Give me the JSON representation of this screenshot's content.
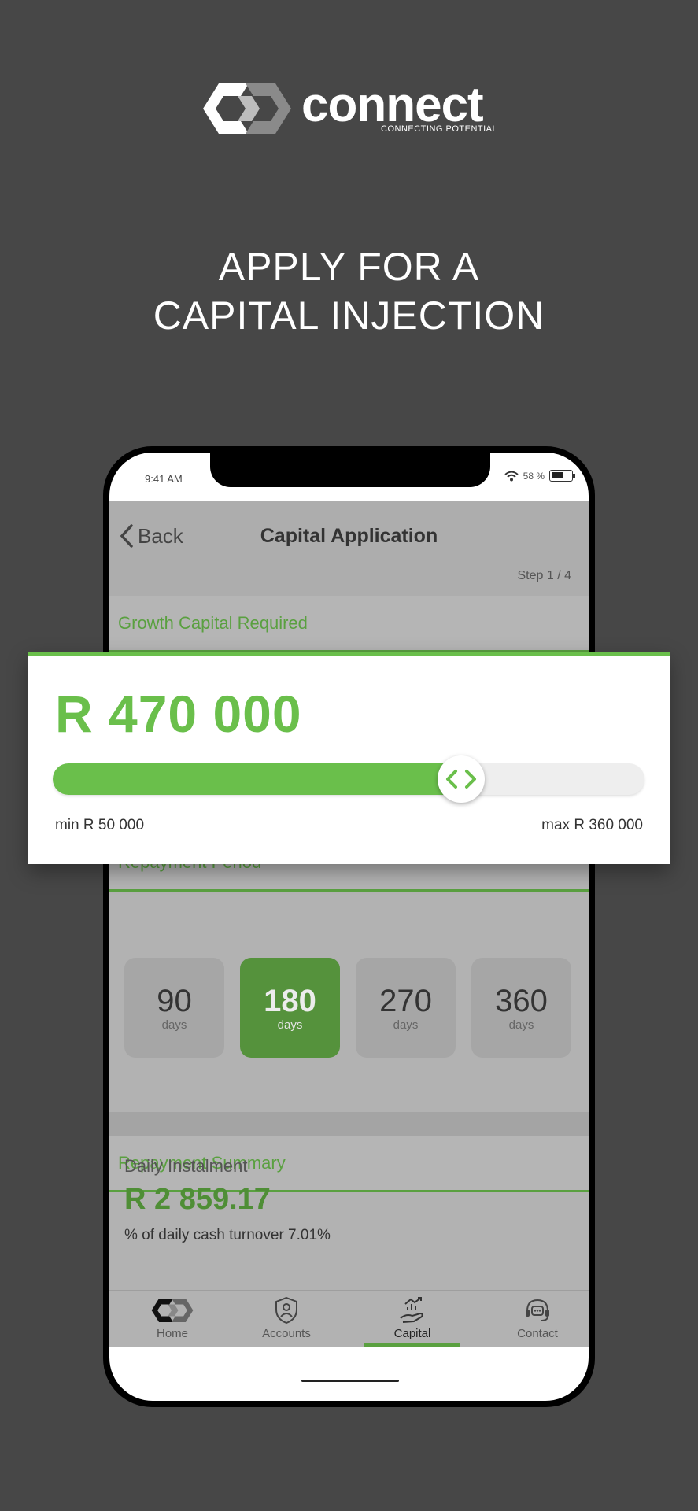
{
  "brand": {
    "name": "connect",
    "tagline": "CONNECTING POTENTIAL"
  },
  "headline": {
    "line1": "APPLY FOR A",
    "line2": "CAPITAL INJECTION"
  },
  "status_bar": {
    "time": "9:41 AM",
    "battery": "58 %"
  },
  "nav": {
    "back_label": "Back",
    "title": "Capital Application",
    "step": "Step 1 / 4"
  },
  "sections": {
    "growth": "Growth Capital Required",
    "repayment_period": "Repayment Period",
    "repayment_summary": "Repayment Summary"
  },
  "slider": {
    "amount": "R 470 000",
    "min_label": "min R 50 000",
    "max_label": "max R 360 000",
    "fill_fraction": 0.69
  },
  "repayment_options": [
    {
      "value": "90",
      "unit": "days",
      "selected": false
    },
    {
      "value": "180",
      "unit": "days",
      "selected": true
    },
    {
      "value": "270",
      "unit": "days",
      "selected": false
    },
    {
      "value": "360",
      "unit": "days",
      "selected": false
    }
  ],
  "summary": {
    "label": "Daily Instalment",
    "amount": "R 2 859.17",
    "turnover": "% of daily cash turnover 7.01%"
  },
  "tabs": [
    {
      "label": "Home",
      "icon": "logo-icon",
      "active": false
    },
    {
      "label": "Accounts",
      "icon": "shield-user-icon",
      "active": false
    },
    {
      "label": "Capital",
      "icon": "hand-growth-icon",
      "active": true
    },
    {
      "label": "Contact",
      "icon": "headset-chat-icon",
      "active": false
    }
  ],
  "colors": {
    "background": "#474747",
    "accent_green": "#6abf4b",
    "dark_green": "#55923c",
    "overlay_gray": "#b2b2b2"
  }
}
